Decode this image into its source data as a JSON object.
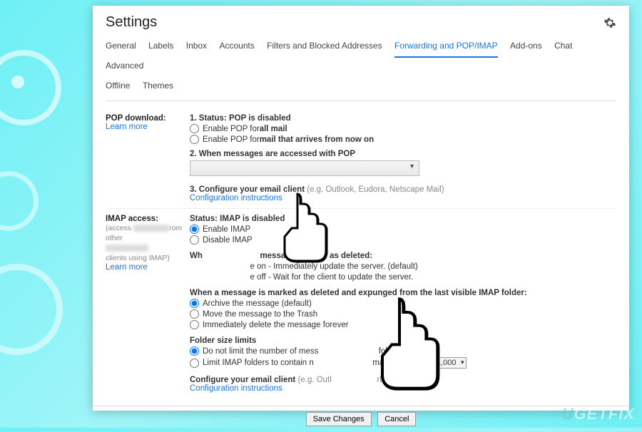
{
  "header": {
    "title": "Settings"
  },
  "tabs": {
    "general": "General",
    "labels": "Labels",
    "inbox": "Inbox",
    "accounts": "Accounts",
    "filters": "Filters and Blocked Addresses",
    "forwarding": "Forwarding and POP/IMAP",
    "addons": "Add-ons",
    "chat": "Chat",
    "advanced": "Advanced",
    "offline": "Offline",
    "themes": "Themes"
  },
  "pop": {
    "heading": "POP download:",
    "learn": "Learn more",
    "status": "1. Status: POP is disabled",
    "opt1_pre": "Enable POP for ",
    "opt1_b": "all mail",
    "opt2_pre": "Enable POP for ",
    "opt2_b": "mail that arrives from now on",
    "when": "2. When messages are accessed with POP",
    "config": "3. Configure your email client ",
    "config_hint": "(e.g. Outlook, Eudora, Netscape Mail)",
    "config_link": "Configuration instructions"
  },
  "imap": {
    "heading": "IMAP access:",
    "sub1": "(access ",
    "sub2": "rom other",
    "sub3": "clients using IMAP)",
    "learn": "Learn more",
    "status": "Status: IMAP is disabled",
    "enable": "Enable IMAP",
    "disable": "Disable IMAP",
    "mark_deleted_title": "message in IMAP as deleted:",
    "mark_deleted_pre": "Wh",
    "md1": "e on - Immediately update the server. (default)",
    "md2": "e off - Wait for the client to update the server.",
    "expunge_title": "When a message is marked as deleted and expunged from the last visible IMAP folder:",
    "ex1": "Archive the message (default)",
    "ex2": "Move the message to the Trash",
    "ex3": "Immediately delete the message forever",
    "folder_title": "Folder size limits",
    "f1_pre": "Do not limit the number of mess",
    "f1_post": " folder (default)",
    "f2_pre": "Limit IMAP folders to contain n",
    "f2_post": " many messages",
    "f2_val": "1,000",
    "conf": "Configure your email client ",
    "conf_hint": "(e.g. Outl",
    "conf_hint2": "rbird, iPhone)",
    "conf_link": "Configuration instructions"
  },
  "buttons": {
    "save": "Save Changes",
    "cancel": "Cancel"
  },
  "watermark": "UGETFIX"
}
